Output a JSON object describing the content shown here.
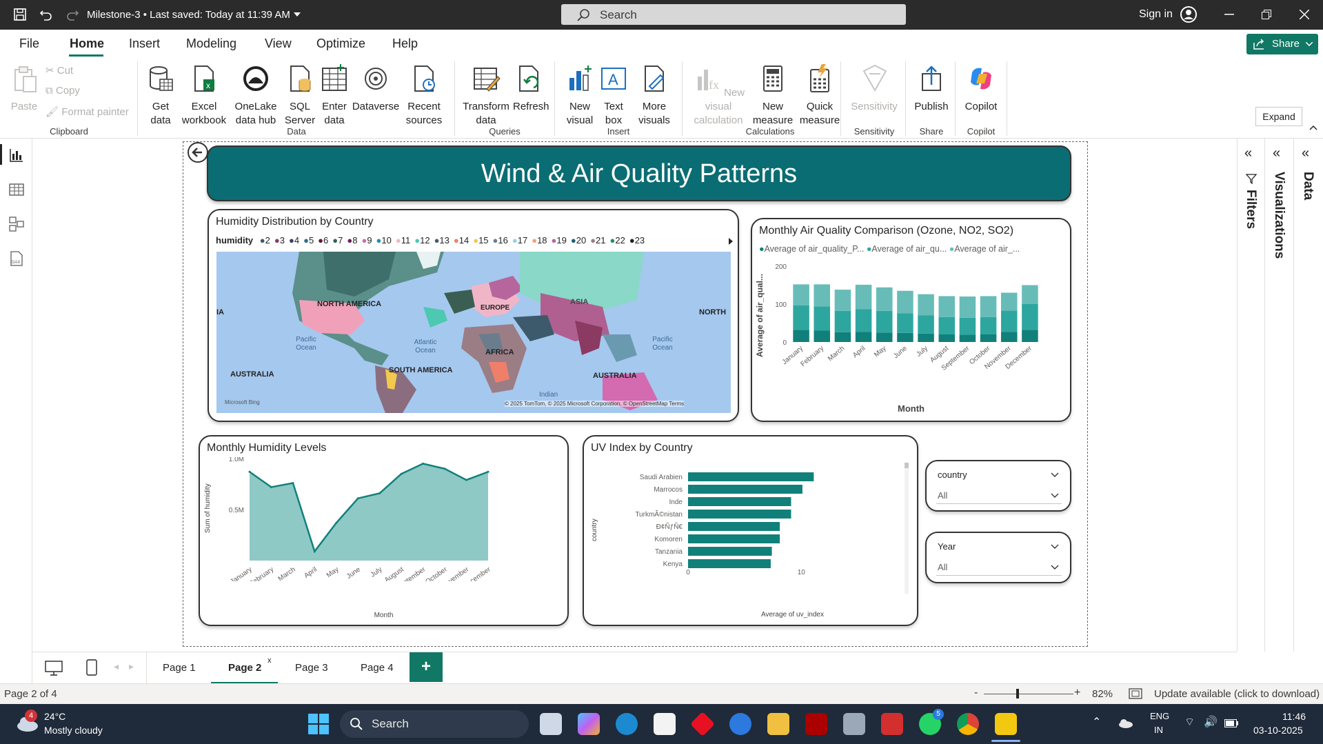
{
  "titlebar": {
    "document_title": "Milestone-3 • Last saved: Today at 11:39 AM",
    "search_placeholder": "Search",
    "signin": "Sign in"
  },
  "menu": {
    "items": [
      "File",
      "Home",
      "Insert",
      "Modeling",
      "View",
      "Optimize",
      "Help"
    ],
    "active": "Home",
    "share_label": "Share"
  },
  "ribbon": {
    "clipboard": {
      "paste": "Paste",
      "cut": "Cut",
      "copy": "Copy",
      "format_painter": "Format painter",
      "label": "Clipboard"
    },
    "data": {
      "get_data": "Get data",
      "excel": "Excel workbook",
      "onelake": "OneLake data hub",
      "sql": "SQL Server",
      "enter_data": "Enter data",
      "dataverse": "Dataverse",
      "recent": "Recent sources",
      "label": "Data"
    },
    "queries": {
      "transform": "Transform data",
      "refresh": "Refresh",
      "label": "Queries"
    },
    "insert": {
      "new_visual": "New visual",
      "text_box": "Text box",
      "more_visuals": "More visuals",
      "label": "Insert"
    },
    "calculations": {
      "new_visual_calc": "New visual calculation",
      "new_measure": "New measure",
      "quick_measure": "Quick measure",
      "label": "Calculations"
    },
    "sensitivity": {
      "btn": "Sensitivity",
      "label": "Sensitivity"
    },
    "share": {
      "publish": "Publish",
      "label": "Share"
    },
    "copilot": {
      "btn": "Copilot",
      "label": "Copilot"
    },
    "expand_tooltip": "Expand"
  },
  "report": {
    "banner_title": "Wind & Air Quality Patterns",
    "map": {
      "title": "Humidity Distribution by Country",
      "legend_title": "humidity",
      "legend": [
        {
          "v": "2",
          "c": "#3d5a6c"
        },
        {
          "v": "3",
          "c": "#8b3a62"
        },
        {
          "v": "4",
          "c": "#3d3d6b"
        },
        {
          "v": "5",
          "c": "#2e6d8e"
        },
        {
          "v": "6",
          "c": "#5e1b3a"
        },
        {
          "v": "7",
          "c": "#3a5e52"
        },
        {
          "v": "8",
          "c": "#6b1f5c"
        },
        {
          "v": "9",
          "c": "#d46ab0"
        },
        {
          "v": "10",
          "c": "#1c8eb8"
        },
        {
          "v": "11",
          "c": "#f0b6c8"
        },
        {
          "v": "12",
          "c": "#4cc9b0"
        },
        {
          "v": "13",
          "c": "#4a5a6a"
        },
        {
          "v": "14",
          "c": "#f07f6a"
        },
        {
          "v": "15",
          "c": "#f2c94c"
        },
        {
          "v": "16",
          "c": "#6a7d8c"
        },
        {
          "v": "17",
          "c": "#8fd3e8"
        },
        {
          "v": "18",
          "c": "#f3a17a"
        },
        {
          "v": "19",
          "c": "#b6669c"
        },
        {
          "v": "20",
          "c": "#1e5e7a"
        },
        {
          "v": "21",
          "c": "#9b7d86"
        },
        {
          "v": "22",
          "c": "#1a8f78"
        },
        {
          "v": "23",
          "c": "#222222"
        }
      ],
      "labels": [
        "NORTH AMERICA",
        "EUROPE",
        "ASIA",
        "AFRICA",
        "SOUTH AMERICA",
        "AUSTRALIA",
        "AUSTRALIA",
        "Pacific Ocean",
        "Atlantic Ocean",
        "Indian",
        "Pacific Ocean",
        "NORTH",
        "IA"
      ],
      "attribution": "© 2025 TomTom, © 2025 Microsoft Corporation, © OpenStreetMap  Terms",
      "ms_logo_text": "Microsoft Bing"
    },
    "aq_chart": {
      "title": "Monthly Air Quality Comparison (Ozone, NO2, SO2)",
      "legend": [
        "Average of air_quality_P...",
        "Average of air_qu...",
        "Average of air_..."
      ],
      "colors": [
        "#11807a",
        "#2ea6a0",
        "#67bcb8"
      ],
      "ylabel": "Average of air_qual...",
      "xlabel": "Month",
      "yticks": [
        "200",
        "100",
        "0"
      ]
    },
    "humidity_chart": {
      "title": "Monthly Humidity Levels",
      "ylabel": "Sum of humidity",
      "xlabel": "Month",
      "yticks": [
        "1.0M",
        "0.5M"
      ]
    },
    "uv_chart": {
      "title": "UV Index by Country",
      "ylabel": "country",
      "xlabel": "Average of uv_index",
      "xticks": [
        "0",
        "10"
      ]
    },
    "slicers": [
      {
        "title": "country",
        "value": "All"
      },
      {
        "title": "Year",
        "value": "All"
      }
    ]
  },
  "chart_data": [
    {
      "type": "bar",
      "stacked": true,
      "title": "Monthly Air Quality Comparison (Ozone, NO2, SO2)",
      "xlabel": "Month",
      "ylabel": "Average of air_qual...",
      "ylim": [
        0,
        200
      ],
      "categories": [
        "January",
        "February",
        "March",
        "April",
        "May",
        "June",
        "July",
        "August",
        "September",
        "October",
        "November",
        "December"
      ],
      "series": [
        {
          "name": "Average of air_quality_P...",
          "values": [
            32,
            30,
            26,
            27,
            25,
            24,
            22,
            20,
            19,
            20,
            27,
            32
          ]
        },
        {
          "name": "Average of air_qu...",
          "values": [
            65,
            64,
            56,
            60,
            57,
            52,
            48,
            46,
            45,
            46,
            56,
            68
          ]
        },
        {
          "name": "Average of air_...",
          "values": [
            55,
            58,
            56,
            64,
            62,
            59,
            56,
            55,
            56,
            55,
            47,
            50
          ]
        }
      ]
    },
    {
      "type": "area",
      "title": "Monthly Humidity Levels",
      "xlabel": "Month",
      "ylabel": "Sum of humidity",
      "categories": [
        "January",
        "February",
        "March",
        "April",
        "May",
        "June",
        "July",
        "August",
        "September",
        "October",
        "November",
        "December"
      ],
      "values": [
        870000,
        720000,
        760000,
        90000,
        370000,
        610000,
        660000,
        850000,
        950000,
        900000,
        790000,
        870000
      ],
      "ylim": [
        0,
        1000000
      ]
    },
    {
      "type": "bar",
      "orientation": "horizontal",
      "title": "UV Index by Country",
      "xlabel": "Average of uv_index",
      "ylabel": "country",
      "categories": [
        "Saudi Arabien",
        "Marrocos",
        "Inde",
        "TurkmÃ©nistan",
        "Ð¢ÑƒÑ€ÐºÐ¼ÐµÐ½Ð¸ÑÑ‚Ð°Ð½",
        "Komoren",
        "Tanzania",
        "Kenya"
      ],
      "display_categories": [
        "Saudi Arabien",
        "Marrocos",
        "Inde",
        "TurkmÃ©nistan",
        "Ð¢ÑƒÑ€",
        "Komoren",
        "Tanzania",
        "Kenya"
      ],
      "values": [
        11.1,
        10.1,
        9.1,
        9.1,
        8.1,
        8.1,
        7.4,
        7.3
      ],
      "xlim": [
        0,
        14
      ]
    }
  ],
  "pages": {
    "tabs": [
      "Page 1",
      "Page 2",
      "Page 3",
      "Page 4"
    ],
    "active": "Page 2",
    "add": "+"
  },
  "statusbar": {
    "page_info": "Page 2 of 4",
    "zoom": "82%",
    "update": "Update available (click to download)"
  },
  "panes": {
    "filters": "Filters",
    "visualizations": "Visualizations",
    "data": "Data"
  },
  "taskbar": {
    "temp": "24°C",
    "weather": "Mostly cloudy",
    "weather_badge": "4",
    "search": "Search",
    "lang1": "ENG",
    "lang2": "IN",
    "time": "11:46",
    "date": "03-10-2025",
    "whatsapp_badge": "5"
  }
}
